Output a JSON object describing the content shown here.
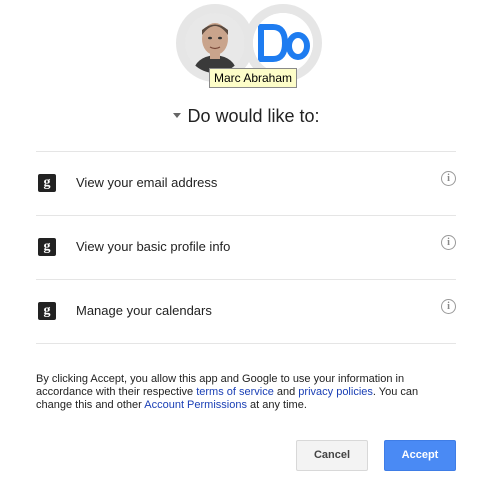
{
  "user": {
    "name": "Marc Abraham",
    "tooltip": "Marc Abraham"
  },
  "app": {
    "name": "Do",
    "logo_text": "Do",
    "logo_color": "#1e7cf0"
  },
  "heading": "Do would like to:",
  "permissions": [
    {
      "icon": "google-icon",
      "icon_glyph": "g",
      "label": "View your email address"
    },
    {
      "icon": "google-icon",
      "icon_glyph": "g",
      "label": "View your basic profile info"
    },
    {
      "icon": "google-icon",
      "icon_glyph": "g",
      "label": "Manage your calendars"
    }
  ],
  "info_glyph": "i",
  "disclaimer": {
    "text_1": "By clicking Accept, you allow this app and Google to use your information in accordance with their respective ",
    "link_terms": "terms of service",
    "text_2": " and ",
    "link_privacy": "privacy policies",
    "text_3": ". You can change this and other ",
    "link_permissions": "Account Permissions",
    "text_4": " at any time."
  },
  "buttons": {
    "cancel": "Cancel",
    "accept": "Accept"
  },
  "colors": {
    "accent": "#4a8af4",
    "link": "#1a3fb5",
    "tooltip_bg": "#fdfdc8"
  }
}
